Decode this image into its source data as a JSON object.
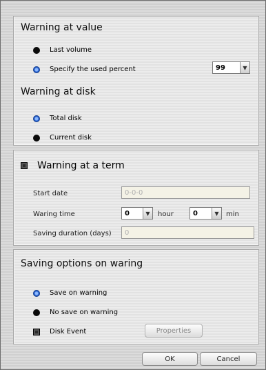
{
  "value_section": {
    "title": "Warning at value",
    "option_last_volume": "Last volume",
    "option_specify_percent": "Specify the used percent",
    "percent_value": "99"
  },
  "disk_section": {
    "title": "Warning at disk",
    "option_total_disk": "Total disk",
    "option_current_disk": "Current disk"
  },
  "term_section": {
    "title": "Warning at a term",
    "start_date_label": "Start date",
    "start_date_value": "0-0-0",
    "waring_time_label": "Waring time",
    "hour_value": "0",
    "hour_unit": "hour",
    "min_value": "0",
    "min_unit": "min",
    "saving_duration_label": "Saving duration (days)",
    "saving_duration_value": "0"
  },
  "saving_section": {
    "title": "Saving options on waring",
    "option_save": "Save on warning",
    "option_no_save": "No save on warning",
    "disk_event_label": "Disk Event",
    "properties_button": "Properties"
  },
  "footer": {
    "ok_button": "OK",
    "cancel_button": "Cancel"
  }
}
